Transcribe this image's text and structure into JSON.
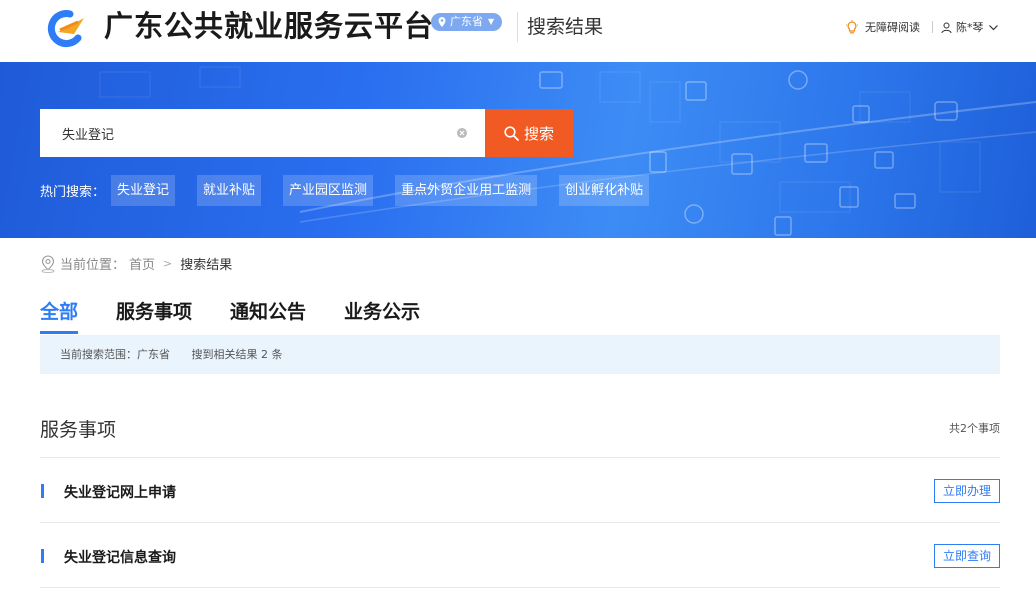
{
  "header": {
    "site_title": "广东公共就业服务云平台",
    "region": "广东省",
    "page_label": "搜索结果",
    "accessibility": "无障碍阅读",
    "user_name": "陈*琴"
  },
  "search": {
    "value": "失业登记",
    "button_label": "搜索",
    "hot_label": "热门搜索：",
    "hot_tags": [
      "失业登记",
      "就业补贴",
      "产业园区监测",
      "重点外贸企业用工监测",
      "创业孵化补贴"
    ]
  },
  "breadcrumb": {
    "prefix": "当前位置：",
    "home": "首页",
    "current": "搜索结果"
  },
  "tabs": [
    "全部",
    "服务事项",
    "通知公告",
    "业务公示"
  ],
  "scope": {
    "range": "当前搜索范围：广东省",
    "result_count": "搜到相关结果 2 条"
  },
  "services": {
    "title": "服务事项",
    "count": "共2个事项",
    "items": [
      {
        "title": "失业登记网上申请",
        "action": "立即办理"
      },
      {
        "title": "失业登记信息查询",
        "action": "立即查询"
      }
    ]
  },
  "colors": {
    "brand_blue": "#2e7cf6",
    "search_orange": "#f15a22",
    "scope_bg": "#eaf4fd"
  }
}
